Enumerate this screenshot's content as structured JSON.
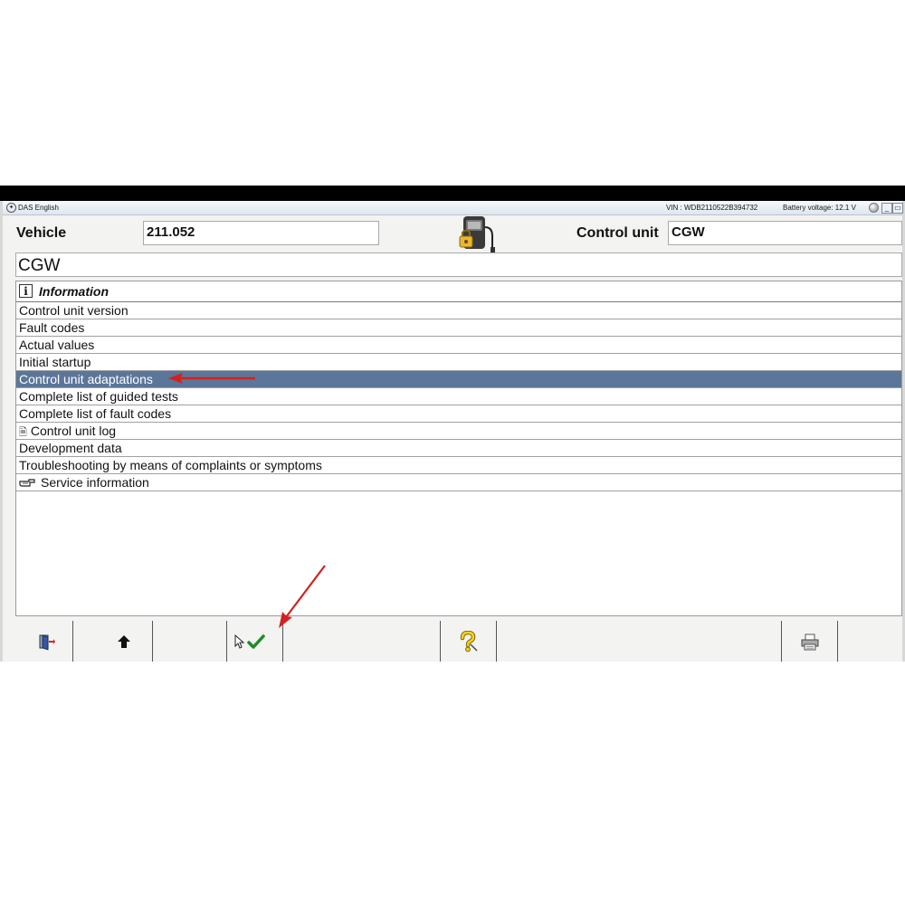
{
  "window": {
    "title": "DAS English",
    "vin": "VIN : WDB2110522B394732",
    "battery": "Battery voltage: 12.1 V",
    "minimize": "_",
    "restore": "▭"
  },
  "header": {
    "vehicle_label": "Vehicle",
    "vehicle_value": "211.052",
    "control_unit_label": "Control unit",
    "control_unit_value": "CGW",
    "unit_name": "CGW"
  },
  "menu": {
    "title": "Information",
    "items": [
      {
        "label": "Control unit version"
      },
      {
        "label": "Fault codes"
      },
      {
        "label": "Actual values"
      },
      {
        "label": "Initial startup"
      },
      {
        "label": "Control unit adaptations",
        "selected": true
      },
      {
        "label": "Complete list of guided tests"
      },
      {
        "label": "Complete list of fault codes"
      },
      {
        "label": "Control unit log",
        "icon": "document-icon"
      },
      {
        "label": "Development data"
      },
      {
        "label": "Troubleshooting by means of complaints or symptoms"
      },
      {
        "label": "Service information",
        "icon": "pointing-hand-icon"
      }
    ]
  },
  "toolbar": {
    "buttons": [
      "exit-door-icon",
      "up-arrow-icon",
      "checkmark-icon",
      "help-icon",
      "printer-icon"
    ]
  },
  "colors": {
    "selection": "#5b7699",
    "annotation_arrow": "#d42020",
    "checkmark": "#1f8a2a"
  }
}
